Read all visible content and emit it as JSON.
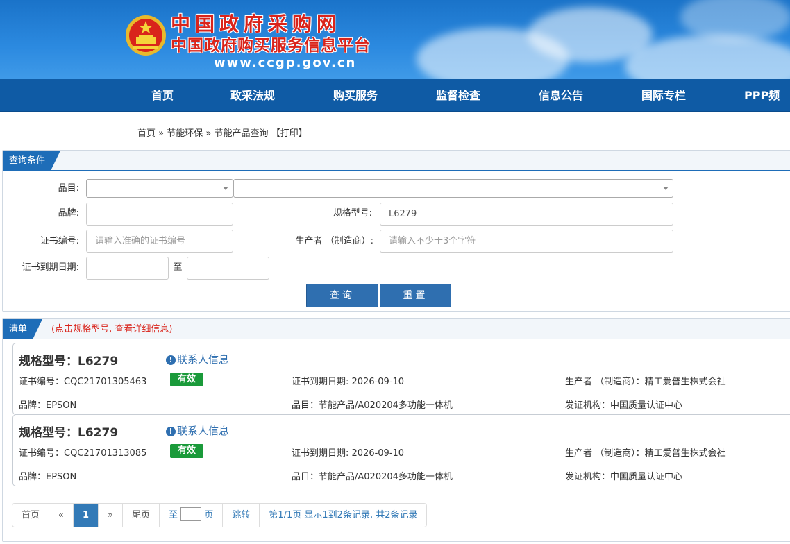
{
  "header": {
    "title": "中国政府采购网",
    "subtitle": "中国政府购买服务信息平台",
    "url": "www.ccgp.gov.cn"
  },
  "nav": [
    "首页",
    "政采法规",
    "购买服务",
    "监督检查",
    "信息公告",
    "国际专栏",
    "PPP频道"
  ],
  "breadcrumb": {
    "home": "首页",
    "sep1": "»",
    "section": "节能环保",
    "sep2": "»",
    "page": "节能产品查询",
    "print": "【打印】"
  },
  "query": {
    "tab": "查询条件",
    "category_label": "品目:",
    "brand_label": "品牌:",
    "model_label": "规格型号:",
    "model_value": "L6279",
    "cert_label": "证书编号:",
    "cert_placeholder": "请输入准确的证书编号",
    "maker_label": "生产者 （制造商）:",
    "maker_placeholder": "请输入不少于3个字符",
    "expiry_label": "证书到期日期:",
    "to": "至",
    "search_btn": "查询",
    "reset_btn": "重置"
  },
  "results": {
    "tab": "清单",
    "note": "(点击规格型号, 查看详细信息)",
    "contact_label": "联系人信息",
    "items": [
      {
        "title": "规格型号：L6279",
        "cert": "证书编号：CQC21701305463",
        "status": "有效",
        "expiry": "证书到期日期: 2026-09-10",
        "maker": "生产者 （制造商）：精工爱普生株式会社",
        "brand": "品牌：EPSON",
        "category": "品目：节能产品/A020204多功能一体机",
        "issuer": "发证机构：中国质量认证中心"
      },
      {
        "title": "规格型号：L6279",
        "cert": "证书编号：CQC21701313085",
        "status": "有效",
        "expiry": "证书到期日期: 2026-09-10",
        "maker": "生产者 （制造商）：精工爱普生株式会社",
        "brand": "品牌：EPSON",
        "category": "品目：节能产品/A020204多功能一体机",
        "issuer": "发证机构：中国质量认证中心"
      }
    ]
  },
  "pager": {
    "first": "首页",
    "prev": "«",
    "current": "1",
    "next": "»",
    "last": "尾页",
    "goto_pre": "至",
    "goto_post": "页",
    "jump": "跳转",
    "summary": "第1/1页 显示1到2条记录, 共2条记录"
  },
  "colors": {
    "nav_bg": "#0f5ba5",
    "accent": "#1e6db8",
    "title_red": "#d9241b",
    "valid_green": "#1a9a3a"
  }
}
